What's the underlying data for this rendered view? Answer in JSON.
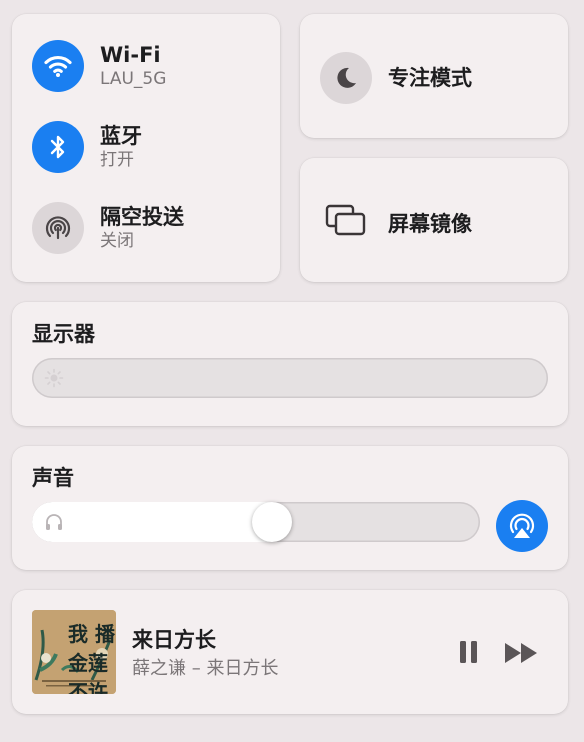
{
  "connectivity": {
    "wifi": {
      "title": "Wi-Fi",
      "subtitle": "LAU_5G",
      "icon": "wifi-icon",
      "state": "on"
    },
    "bluetooth": {
      "title": "蓝牙",
      "subtitle": "打开",
      "icon": "bluetooth-icon",
      "state": "on"
    },
    "airdrop": {
      "title": "隔空投送",
      "subtitle": "关闭",
      "icon": "airdrop-icon",
      "state": "off"
    }
  },
  "focus": {
    "title": "专注模式",
    "icon": "moon-icon"
  },
  "screen_mirroring": {
    "title": "屏幕镜像",
    "icon": "screen-mirror-icon"
  },
  "display": {
    "title": "显示器",
    "brightness_fraction": 0.0,
    "icon": "sun-icon"
  },
  "sound": {
    "title": "声音",
    "volume_fraction": 0.54,
    "icon": "headphones-icon",
    "output_icon": "airplay-audio-icon"
  },
  "now_playing": {
    "track": "来日方长",
    "subtitle": "薛之谦 – 来日方长",
    "album_art_text": "我 播金莲 不许",
    "pause_icon": "pause-icon",
    "forward_icon": "fast-forward-icon"
  },
  "colors": {
    "accent": "#1a7ff1",
    "card": "#f4eff0",
    "background": "#ece6e8"
  }
}
